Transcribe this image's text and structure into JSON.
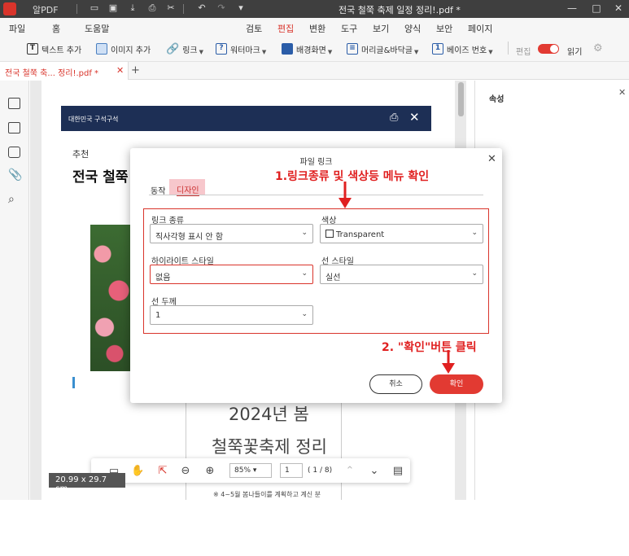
{
  "titlebar": {
    "app_name": "알PDF",
    "doc_title": "전국 철쭉 축제 일정 정리!.pdf *",
    "min": "—",
    "max": "□",
    "close": "✕"
  },
  "menu": {
    "left": [
      "파일",
      "홈",
      "도움말"
    ],
    "center": [
      "검토",
      "편집",
      "변환",
      "도구",
      "보기",
      "양식",
      "보안",
      "페이지"
    ],
    "active": "편집"
  },
  "toolbar": {
    "text_add": "텍스트 추가",
    "image_add": "이미지 추가",
    "link": "링크",
    "watermark": "워터마크",
    "background": "배경화면",
    "header_footer": "머리글&바닥글",
    "bates": "베이즈 번호",
    "edit": "편집",
    "read": "읽기"
  },
  "tabs": {
    "doc_tab": "전국 철쭉 축... 정리!.pdf *",
    "close": "✕",
    "add": "+"
  },
  "right_panel": {
    "title": "속성",
    "close": "✕"
  },
  "document": {
    "banner": "대한민국 구석구석",
    "small": "추천",
    "heading": "전국 철쭉",
    "poster_line1": "2024년 봄",
    "poster_line2": "철쭉꽃축제 정리",
    "footnote": "※ 4~5월 봄나들이를 계획하고 계신 분"
  },
  "bottom_toolbar": {
    "zoom": "85%",
    "page": "1",
    "page_count": "( 1 / 8)",
    "page_size": "20.99 x 29.7 cm"
  },
  "dialog": {
    "title": "파일 링크",
    "close": "✕",
    "tab_action": "동작",
    "tab_design": "디자인",
    "link_type_label": "링크 종류",
    "link_type_value": "직사각형 표시 안 함",
    "color_label": "색상",
    "color_value": "Transparent",
    "highlight_label": "하이라이트 스타일",
    "highlight_value": "없음",
    "line_style_label": "선 스타일",
    "line_style_value": "실선",
    "line_width_label": "선 두께",
    "line_width_value": "1",
    "cancel": "취소",
    "ok": "확인"
  },
  "annotations": {
    "step1": "1.링크종류 및 색상등 메뉴 확인",
    "step2": "2. \"확인\"버튼 클릭"
  },
  "colors": {
    "accent": "#e23a32",
    "banner": "#1d2f55",
    "annotation": "#e02020"
  }
}
